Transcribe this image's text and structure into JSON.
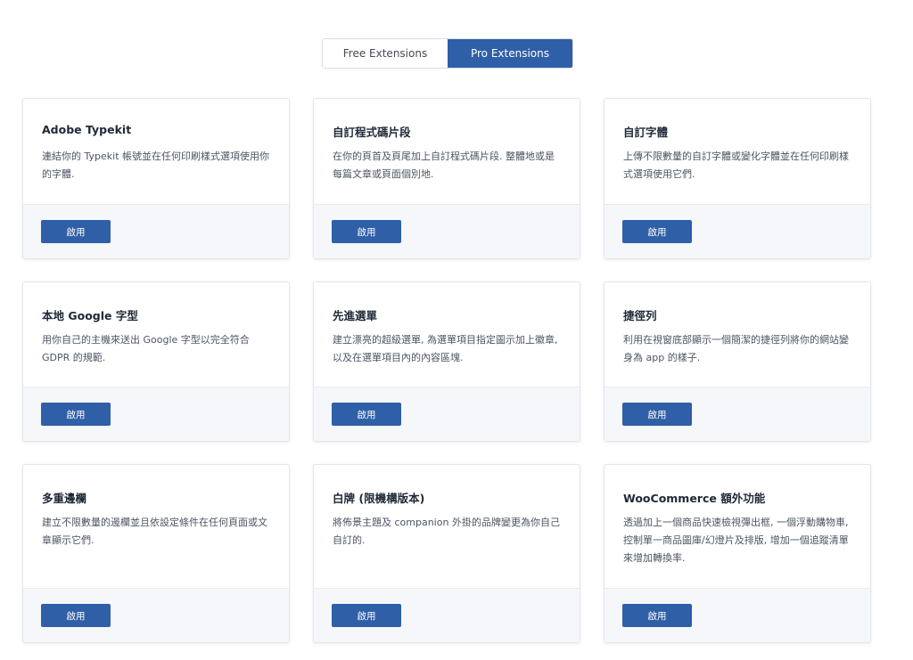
{
  "tabs": {
    "free_label": "Free Extensions",
    "pro_label": "Pro Extensions",
    "active": "pro"
  },
  "colors": {
    "accent": "#2f5fa7",
    "footer_bg": "#f5f7fa",
    "border": "#e3e7ec"
  },
  "cards": [
    {
      "title": "Adobe Typekit",
      "description": "連結你的 Typekit 帳號並在任何印刷樣式選項使用你的字體.",
      "button": "啟用"
    },
    {
      "title": "自訂程式碼片段",
      "description": "在你的頁首及頁尾加上自訂程式碼片段. 整體地或是每篇文章或頁面個別地.",
      "button": "啟用"
    },
    {
      "title": "自訂字體",
      "description": "上傳不限數量的自訂字體或變化字體並在任何印刷樣式選項使用它們.",
      "button": "啟用"
    },
    {
      "title": "本地 Google 字型",
      "description": "用你自己的主機來送出 Google 字型以完全符合 GDPR 的規範.",
      "button": "啟用"
    },
    {
      "title": "先進選單",
      "description": "建立漂亮的超級選單, 為選單項目指定圖示加上徽章, 以及在選單項目內的內容區塊.",
      "button": "啟用"
    },
    {
      "title": "捷徑列",
      "description": "利用在視窗底部顯示一個簡潔的捷徑列將你的網站變身為 app 的樣子.",
      "button": "啟用"
    },
    {
      "title": "多重邊欄",
      "description": "建立不限數量的邊欄並且依設定條件在任何頁面或文章顯示它們.",
      "button": "啟用"
    },
    {
      "title": "白牌 (限機構版本)",
      "description": "將佈景主題及 companion 外掛的品牌變更為你自己自訂的.",
      "button": "啟用"
    },
    {
      "title": "WooCommerce 額外功能",
      "description": "透過加上一個商品快速檢視彈出框, 一個浮動購物車, 控制單一商品圖庫/幻燈片及排版, 增加一個追蹤清單來增加轉換率.",
      "button": "啟用"
    }
  ]
}
